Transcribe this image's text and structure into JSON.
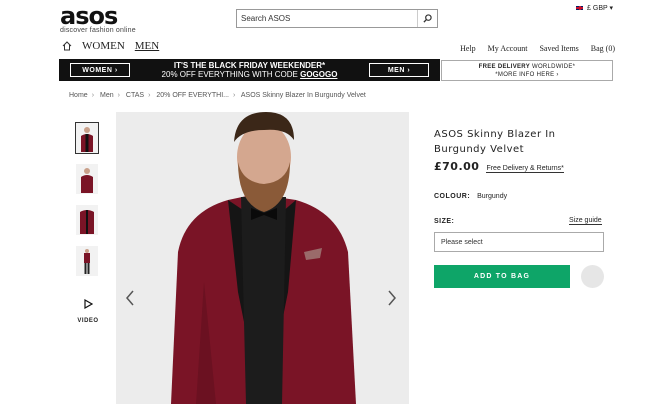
{
  "header": {
    "logo": "asos",
    "tagline": "discover fashion online",
    "search_value": "Search ASOS",
    "locale": "£ GBP ▾"
  },
  "gender_nav": {
    "women": "WOMEN",
    "men": "MEN"
  },
  "util_nav": {
    "help": "Help",
    "account": "My Account",
    "saved": "Saved Items",
    "bag": "Bag (0)"
  },
  "promo": {
    "women_btn": "WOMEN ›",
    "men_btn": "MEN ›",
    "line1": "IT'S THE BLACK FRIDAY WEEKENDER*",
    "line2_prefix": "20% OFF EVERYTHING WITH CODE ",
    "code": "GOGOGO"
  },
  "delivery_banner": {
    "bold": "FREE DELIVERY",
    "rest": " WORLDWIDE*",
    "more": "*MORE INFO HERE ›"
  },
  "breadcrumb": [
    "Home",
    "Men",
    "CTAS",
    "20% OFF EVERYTHI...",
    "ASOS Skinny Blazer In Burgundy Velvet"
  ],
  "gallery": {
    "video_label": "VIDEO"
  },
  "product": {
    "title": "ASOS Skinny Blazer In Burgundy Velvet",
    "price": "£70.00",
    "free_delivery": "Free Delivery & Returns*",
    "colour_label": "COLOUR:",
    "colour_value": "Burgundy",
    "size_label": "SIZE:",
    "size_guide": "Size guide",
    "size_placeholder": "Please select",
    "add_to_bag": "ADD TO BAG"
  },
  "colors": {
    "accent_green": "#0ea568",
    "burgundy": "#7a1426",
    "promo_bg": "#111111"
  }
}
